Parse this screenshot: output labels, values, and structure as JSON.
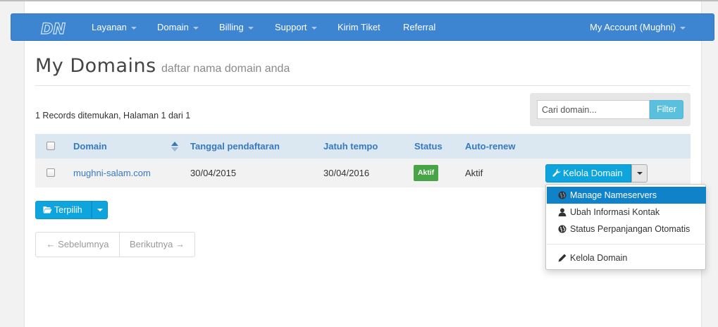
{
  "navbar": {
    "logo_text": "DN",
    "items": [
      {
        "label": "Layanan",
        "has_caret": true
      },
      {
        "label": "Domain",
        "has_caret": true
      },
      {
        "label": "Billing",
        "has_caret": true
      },
      {
        "label": "Support",
        "has_caret": true
      },
      {
        "label": "Kirim Tiket",
        "has_caret": false
      },
      {
        "label": "Referral",
        "has_caret": false
      }
    ],
    "account_label": "My Account (Mughni)",
    "background_color": "#3d85d1"
  },
  "page": {
    "title": "My Domains",
    "subtitle": "daftar nama domain anda",
    "records_text": "1 Records ditemukan, Halaman 1 dari 1"
  },
  "search": {
    "placeholder": "Cari domain...",
    "filter_label": "Filter"
  },
  "table": {
    "headers": {
      "domain": "Domain",
      "registration_date": "Tanggal pendaftaran",
      "due_date": "Jatuh tempo",
      "status": "Status",
      "auto_renew": "Auto-renew"
    },
    "rows": [
      {
        "domain": "mughni-salam.com",
        "registration_date": "30/04/2015",
        "due_date": "30/04/2016",
        "status": "Aktif",
        "auto_renew": "Aktif",
        "action_label": "Kelola Domain"
      }
    ]
  },
  "dropdown_menu": {
    "items": [
      {
        "label": "Manage Nameservers",
        "icon": "globe-icon",
        "active": true
      },
      {
        "label": "Ubah Informasi Kontak",
        "icon": "user-icon",
        "active": false
      },
      {
        "label": "Status Perpanjangan Otomatis",
        "icon": "globe-icon",
        "active": false
      },
      {
        "label": "Kelola Domain",
        "icon": "pencil-icon",
        "active": false
      }
    ]
  },
  "bulk_action": {
    "label": "Terpilih",
    "icon": "folder-open-icon"
  },
  "pagination": {
    "prev_label": "← Sebelumnya",
    "next_label": "Berikutnya →"
  },
  "colors": {
    "accent": "#0ea5df",
    "link": "#3779c1",
    "status_active": "#47a447",
    "table_header_bg": "#dbe7f1"
  }
}
